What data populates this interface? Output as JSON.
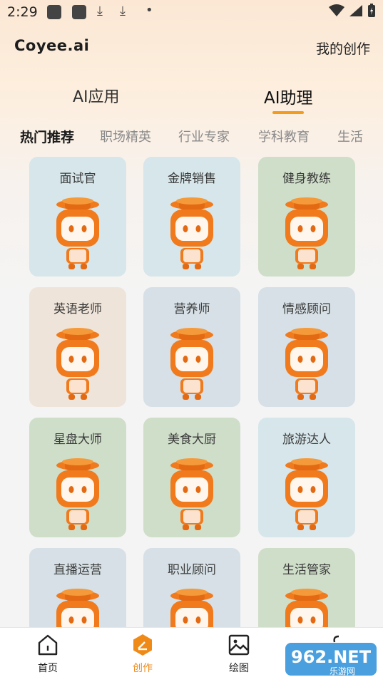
{
  "status": {
    "time": "2:29"
  },
  "header": {
    "logo": "Coyee.ai",
    "my_works": "我的创作"
  },
  "main_tabs": [
    {
      "label": "AI应用"
    },
    {
      "label": "AI助理"
    }
  ],
  "sub_tabs": [
    {
      "label": "热门推荐"
    },
    {
      "label": "职场精英"
    },
    {
      "label": "行业专家"
    },
    {
      "label": "学科教育"
    },
    {
      "label": "生活"
    }
  ],
  "cards": [
    {
      "title": "面试官",
      "bg": "#d6e6ea"
    },
    {
      "title": "金牌销售",
      "bg": "#d6e6ea"
    },
    {
      "title": "健身教练",
      "bg": "#cfdec9"
    },
    {
      "title": "英语老师",
      "bg": "#efe4d9"
    },
    {
      "title": "营养师",
      "bg": "#d6e0e6"
    },
    {
      "title": "情感顾问",
      "bg": "#d6e0e6"
    },
    {
      "title": "星盘大师",
      "bg": "#cfdec9"
    },
    {
      "title": "美食大厨",
      "bg": "#cfdec9"
    },
    {
      "title": "旅游达人",
      "bg": "#d6e6ea"
    },
    {
      "title": "直播运营",
      "bg": "#d6e0e6"
    },
    {
      "title": "职业顾问",
      "bg": "#d6e0e6"
    },
    {
      "title": "生活管家",
      "bg": "#cfdec9"
    }
  ],
  "bottom_nav": [
    {
      "label": "首页"
    },
    {
      "label": "创作"
    },
    {
      "label": "绘图"
    }
  ],
  "watermark": {
    "text": "962.NET",
    "sub": "乐游网"
  },
  "colors": {
    "accent": "#f39b1e",
    "mascot": "#f07a1c"
  }
}
